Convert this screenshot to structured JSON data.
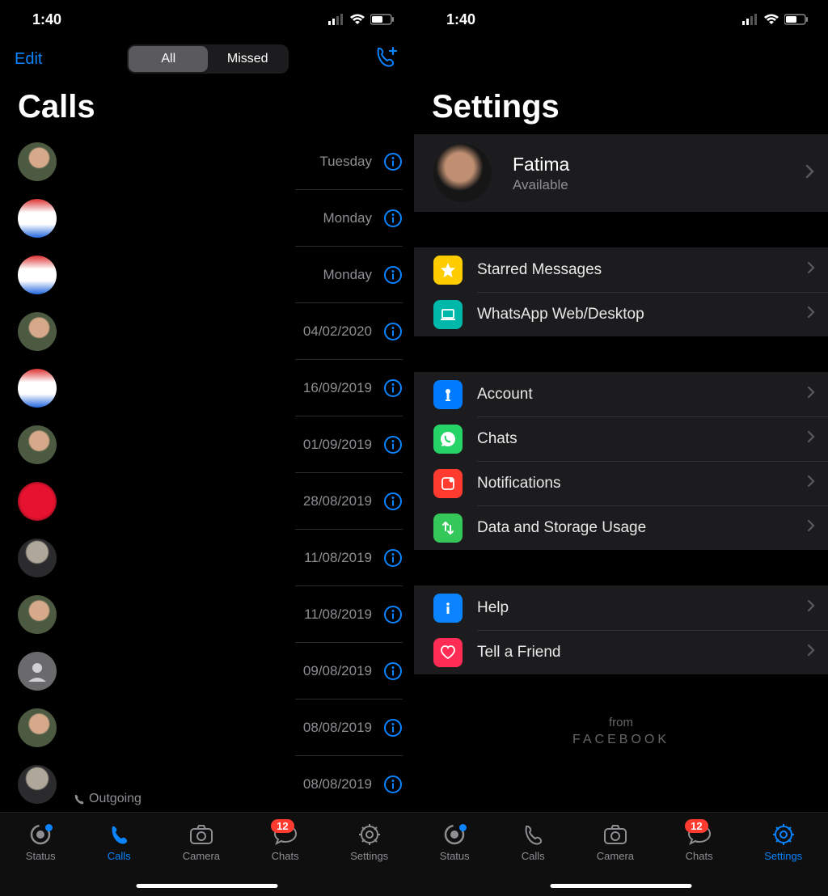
{
  "status_bar": {
    "time": "1:40"
  },
  "calls_screen": {
    "edit_label": "Edit",
    "seg_all": "All",
    "seg_missed": "Missed",
    "title": "Calls",
    "rows": [
      {
        "date": "Tuesday",
        "avatar": "av-hijab"
      },
      {
        "date": "Monday",
        "avatar": "av-store"
      },
      {
        "date": "Monday",
        "avatar": "av-store"
      },
      {
        "date": "04/02/2020",
        "avatar": "av-hijab"
      },
      {
        "date": "16/09/2019",
        "avatar": "av-store"
      },
      {
        "date": "01/09/2019",
        "avatar": "av-hijab"
      },
      {
        "date": "28/08/2019",
        "avatar": "av-rose"
      },
      {
        "date": "11/08/2019",
        "avatar": "av-man"
      },
      {
        "date": "11/08/2019",
        "avatar": "av-hijab"
      },
      {
        "date": "09/08/2019",
        "avatar": "av-default"
      },
      {
        "date": "08/08/2019",
        "avatar": "av-hijab"
      },
      {
        "date": "08/08/2019",
        "avatar": "av-man",
        "sub": "Outgoing"
      }
    ]
  },
  "settings_screen": {
    "title": "Settings",
    "profile": {
      "name": "Fatima",
      "status": "Available"
    },
    "group1": [
      {
        "label": "Starred Messages",
        "icon": "ic-yellow",
        "name": "starred-messages"
      },
      {
        "label": "WhatsApp Web/Desktop",
        "icon": "ic-teal",
        "name": "whatsapp-web"
      }
    ],
    "group2": [
      {
        "label": "Account",
        "icon": "ic-blue",
        "name": "account"
      },
      {
        "label": "Chats",
        "icon": "ic-green",
        "name": "chats-settings"
      },
      {
        "label": "Notifications",
        "icon": "ic-red",
        "name": "notifications"
      },
      {
        "label": "Data and Storage Usage",
        "icon": "ic-green2",
        "name": "data-storage"
      }
    ],
    "group3": [
      {
        "label": "Help",
        "icon": "ic-blue2",
        "name": "help"
      },
      {
        "label": "Tell a Friend",
        "icon": "ic-pink",
        "name": "tell-friend"
      }
    ],
    "footer_from": "from",
    "footer_brand": "FACEBOOK"
  },
  "tabs": {
    "items": [
      "Status",
      "Calls",
      "Camera",
      "Chats",
      "Settings"
    ],
    "chats_badge": "12"
  }
}
